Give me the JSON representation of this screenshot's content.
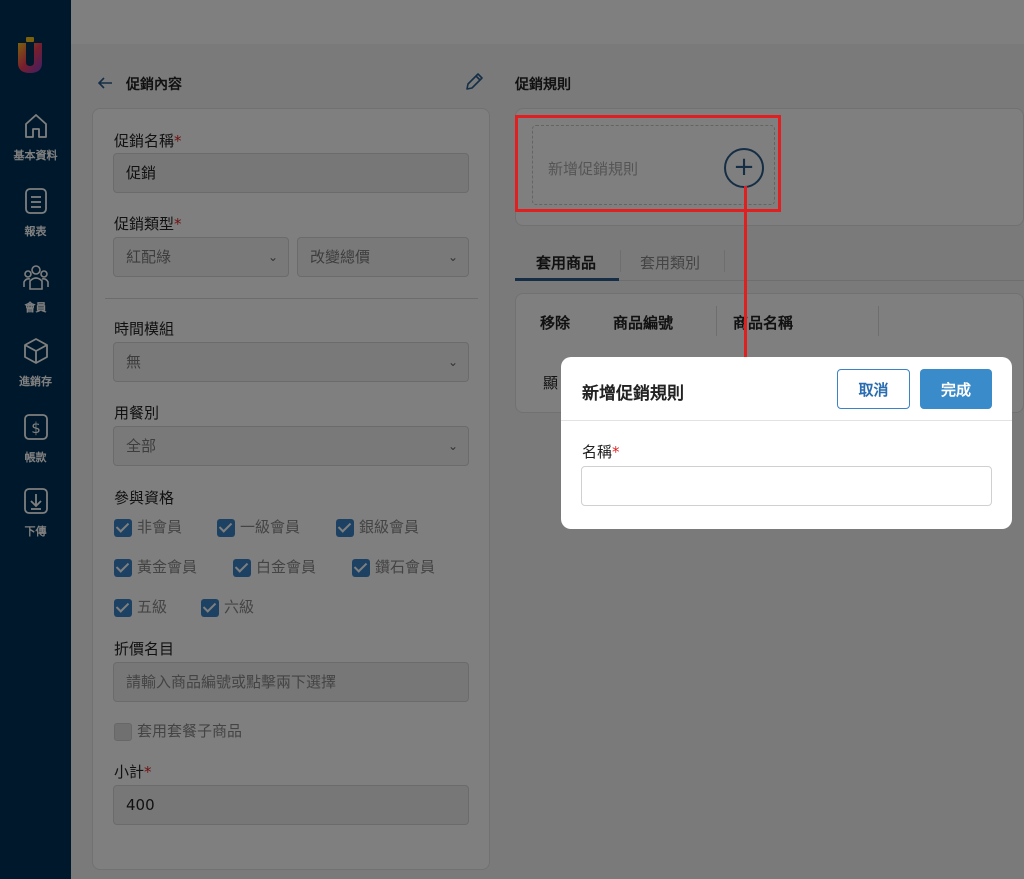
{
  "sidebar": {
    "items": [
      {
        "label": "基本資料",
        "icon": "home-icon"
      },
      {
        "label": "報表",
        "icon": "report-icon"
      },
      {
        "label": "會員",
        "icon": "members-icon"
      },
      {
        "label": "進銷存",
        "icon": "inventory-box-icon"
      },
      {
        "label": "帳款",
        "icon": "dollar-icon"
      },
      {
        "label": "下傳",
        "icon": "download-icon"
      }
    ]
  },
  "left": {
    "title": "促銷內容",
    "promo_name_label": "促銷名稱",
    "promo_name_value": "促銷",
    "promo_type_label": "促銷類型",
    "promo_type_1": "紅配綠",
    "promo_type_2": "改變總價",
    "time_module_label": "時間模組",
    "time_module_value": "無",
    "meal_type_label": "用餐別",
    "meal_type_value": "全部",
    "eligibility_label": "參與資格",
    "eligibility": [
      {
        "label": "非會員",
        "checked": true
      },
      {
        "label": "一級會員",
        "checked": true
      },
      {
        "label": "銀級會員",
        "checked": true
      },
      {
        "label": "黃金會員",
        "checked": true
      },
      {
        "label": "白金會員",
        "checked": true
      },
      {
        "label": "鑽石會員",
        "checked": true
      },
      {
        "label": "五級",
        "checked": true
      },
      {
        "label": "六級",
        "checked": true
      }
    ],
    "discount_item_label": "折價名目",
    "discount_item_placeholder": "請輸入商品編號或點擊兩下選擇",
    "combo_label": "套用套餐子商品",
    "subtotal_label": "小計",
    "subtotal_value": "400"
  },
  "right": {
    "title": "促銷規則",
    "rule_placeholder": "新增促銷規則",
    "tabs": [
      "套用商品",
      "套用類別"
    ],
    "columns": [
      "移除",
      "商品編號",
      "商品名稱"
    ],
    "row_text": "顯"
  },
  "modal": {
    "title": "新增促銷規則",
    "cancel_label": "取消",
    "done_label": "完成",
    "name_label": "名稱",
    "name_value": ""
  },
  "colors": {
    "sidebar": "#003057",
    "accent": "#3a8bc9",
    "highlight": "#e02020"
  }
}
